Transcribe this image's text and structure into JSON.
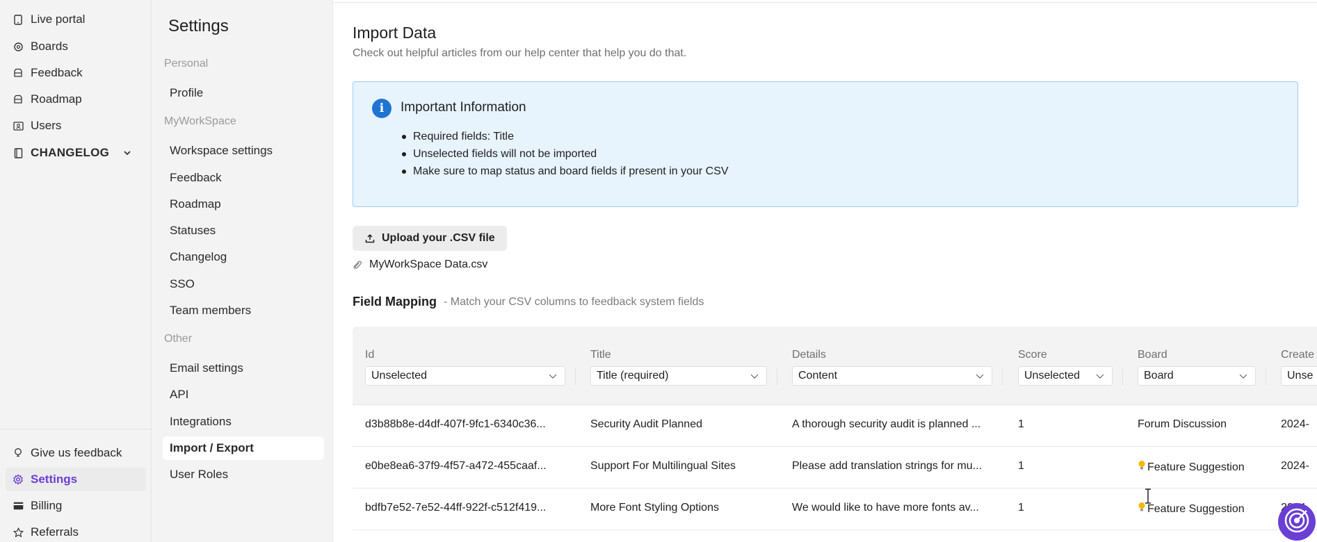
{
  "app": {
    "accent_color": "#6b3fd4",
    "info_color": "#1f74d1"
  },
  "leftnav": {
    "items": [
      {
        "label": "Live portal",
        "icon": "tablet-icon"
      },
      {
        "label": "Boards",
        "icon": "gear-like-icon"
      },
      {
        "label": "Feedback",
        "icon": "inbox-icon"
      },
      {
        "label": "Roadmap",
        "icon": "inbox-icon"
      },
      {
        "label": "Users",
        "icon": "user-card-icon"
      },
      {
        "label": "CHANGELOG",
        "icon": "book-icon"
      }
    ],
    "bottom_items": [
      {
        "label": "Give us feedback",
        "icon": "lightbulb-icon"
      },
      {
        "label": "Settings",
        "icon": "gear-icon"
      },
      {
        "label": "Billing",
        "icon": "credit-card-icon"
      },
      {
        "label": "Referrals",
        "icon": "star-icon"
      }
    ]
  },
  "settings": {
    "title": "Settings",
    "sections": [
      {
        "label": "Personal",
        "items": [
          "Profile"
        ]
      },
      {
        "label": "MyWorkSpace",
        "items": [
          "Workspace settings",
          "Feedback",
          "Roadmap",
          "Statuses",
          "Changelog",
          "SSO",
          "Team members"
        ]
      },
      {
        "label": "Other",
        "items": [
          "Email settings",
          "API",
          "Integrations",
          "Import / Export",
          "User Roles"
        ]
      }
    ],
    "active_item": "Import / Export"
  },
  "main": {
    "title": "Import Data",
    "subtitle": "Check out helpful articles from our help center that help you do that.",
    "info": {
      "title": "Important Information",
      "icon_glyph": "i",
      "bullets": [
        "Required fields: Title",
        "Unselected fields will not be imported",
        "Make sure to map status and board fields if present in your CSV"
      ]
    },
    "upload_label": "Upload your .CSV file",
    "file_name": "MyWorkSpace Data.csv",
    "field_mapping": {
      "title": "Field Mapping",
      "subtitle": "- Match your CSV columns to feedback system fields"
    },
    "columns": [
      {
        "header": "Id",
        "selected": "Unselected"
      },
      {
        "header": "Title",
        "selected": "Title (required)"
      },
      {
        "header": "Details",
        "selected": "Content"
      },
      {
        "header": "Score",
        "selected": "Unselected"
      },
      {
        "header": "Board",
        "selected": "Board"
      },
      {
        "header": "Create",
        "selected": "Unse"
      }
    ],
    "rows": [
      [
        "d3b88b8e-d4df-407f-9fc1-6340c36...",
        "Security Audit Planned",
        "A thorough security audit is planned ...",
        "1",
        "Forum Discussion",
        "2024-"
      ],
      [
        "e0be8ea6-37f9-4f57-a472-455caaf...",
        "Support For Multilingual Sites",
        "Please add translation strings for mu...",
        "1",
        "Feature Suggestion",
        "2024-"
      ],
      [
        "bdfb7e52-7e52-44ff-922f-c512f419...",
        "More Font Styling Options",
        "We would like to have more fonts av...",
        "1",
        "Feature Suggestion",
        "2024-"
      ]
    ]
  }
}
